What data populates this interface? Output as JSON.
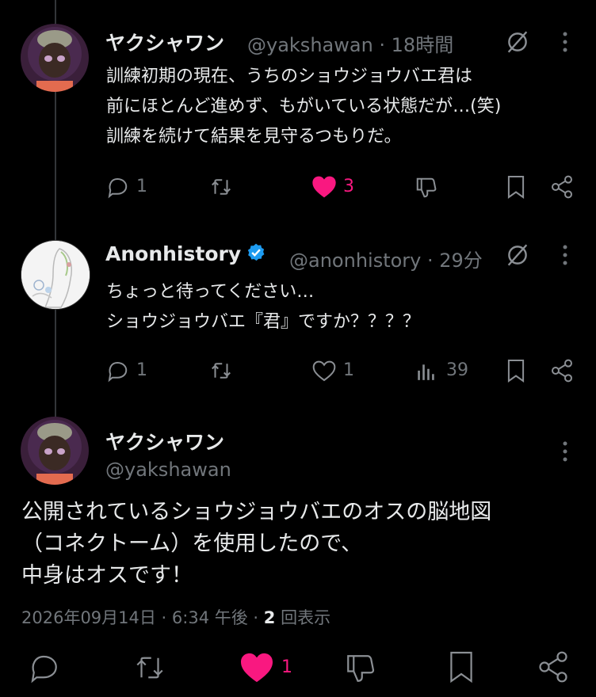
{
  "tweets": [
    {
      "display_name": "ヤクシャワン",
      "handle": "@yakshawan · 18時間",
      "lines": [
        "訓練初期の現在、うちのショウジョウバエ君は",
        "前にほとんど進めず、もがいている状態だが…(笑)",
        "訓練を続けて結果を見守るつもりだ。"
      ],
      "reply_count": "1",
      "like_count": "3",
      "liked": true
    },
    {
      "display_name": "Anonhistory",
      "handle": "@anonhistory · 29分",
      "verified": true,
      "lines": [
        "ちょっと待ってください…",
        "ショウジョウバエ『君』ですか？？？？"
      ],
      "reply_count": "1",
      "like_count": "1",
      "views_count": "39"
    }
  ],
  "main_tweet": {
    "display_name": "ヤクシャワン",
    "handle": "@yakshawan",
    "lines": [
      "公開されているショウジョウバエのオスの脳地図",
      "（コネクトーム）を使用したので、",
      "中身はオスです！"
    ],
    "timestamp": "2026年09月14日 · 6:34 午後 · ",
    "views_number": "2",
    "views_label": " 回表示",
    "like_count": "1"
  },
  "colors": {
    "background": "#000000",
    "text": "#e7e9ea",
    "muted": "#71767b",
    "like": "#f91880",
    "verified": "#1d9bf0"
  }
}
